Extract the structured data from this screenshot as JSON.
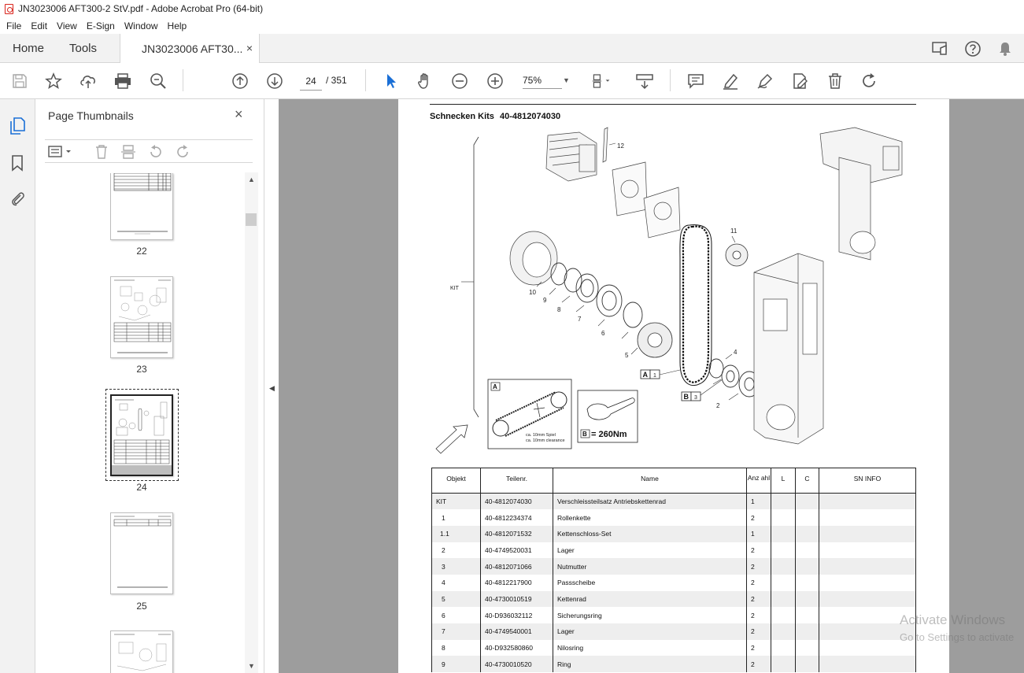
{
  "window": {
    "title": "JN3023006 AFT300-2 StV.pdf - Adobe Acrobat Pro (64-bit)"
  },
  "menu": [
    "File",
    "Edit",
    "View",
    "E-Sign",
    "Window",
    "Help"
  ],
  "tabs": {
    "home": "Home",
    "tools": "Tools",
    "document": "JN3023006 AFT30...",
    "close": "×"
  },
  "toolbar": {
    "current_page": "24",
    "page_of": "/  351",
    "zoom": "75%"
  },
  "thumbnails": {
    "title": "Page Thumbnails",
    "close": "×",
    "pages": [
      {
        "label": "22"
      },
      {
        "label": "23"
      },
      {
        "label": "24",
        "selected": true
      },
      {
        "label": "25"
      }
    ]
  },
  "document": {
    "heading": "Schnecken Kits",
    "heading_number": "40-4812074030",
    "callouts": {
      "kit": "KIT",
      "c12": "12",
      "c11": "11",
      "c10": "10",
      "c9": "9",
      "c8": "8",
      "c7": "7",
      "c6": "6",
      "c5": "5",
      "c4": "4",
      "c3": "3",
      "c2": "2",
      "a": "A",
      "a1": "1",
      "b": "B",
      "b3": "3",
      "detail_a": "A",
      "detail_b": "B",
      "torque": "= 260Nm",
      "spiel1": "ca. 10mm Spiel",
      "spiel2": "ca. 10mm clearance"
    },
    "table": {
      "headers": [
        "Objekt",
        "Teilenr.",
        "Name",
        "Anz ahl",
        "L",
        "C",
        "SN INFO"
      ],
      "rows": [
        [
          "KIT",
          "40-4812074030",
          "Verschleissteilsatz Antriebskettenrad",
          "1"
        ],
        [
          "1",
          "40-4812234374",
          "Rollenkette",
          "2"
        ],
        [
          "1.1",
          "40-4812071532",
          "Kettenschloss-Set",
          "1"
        ],
        [
          "2",
          "40-4749520031",
          "Lager",
          "2"
        ],
        [
          "3",
          "40-4812071066",
          "Nutmutter",
          "2"
        ],
        [
          "4",
          "40-4812217900",
          "Passscheibe",
          "2"
        ],
        [
          "5",
          "40-4730010519",
          "Kettenrad",
          "2"
        ],
        [
          "6",
          "40-D936032112",
          "Sicherungsring",
          "2"
        ],
        [
          "7",
          "40-4749540001",
          "Lager",
          "2"
        ],
        [
          "8",
          "40-D932580860",
          "Nilosring",
          "2"
        ],
        [
          "9",
          "40-4730010520",
          "Ring",
          "2"
        ]
      ]
    }
  },
  "watermark": {
    "line1": "Activate Windows",
    "line2": "Go to Settings to activate"
  }
}
